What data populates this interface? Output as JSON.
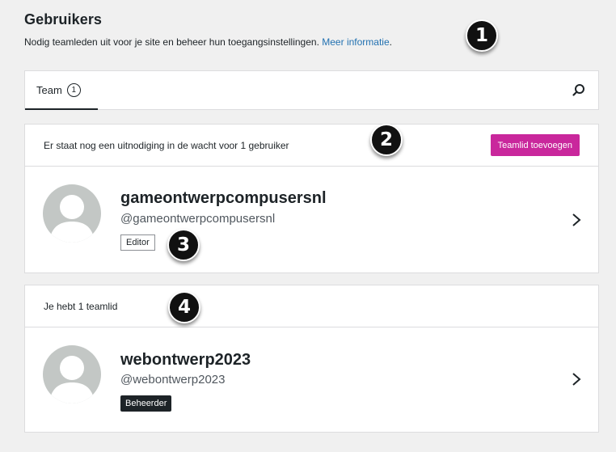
{
  "header": {
    "title": "Gebruikers",
    "subtitle": "Nodig teamleden uit voor je site en beheer hun toegangsinstellingen.",
    "link_label": "Meer informatie",
    "link_suffix": "."
  },
  "callouts": [
    "1",
    "2",
    "3",
    "4"
  ],
  "tabs": [
    {
      "label": "Team",
      "count": "1",
      "active": true
    }
  ],
  "icons": {
    "search": "search-icon",
    "chevron": "chevron-right-icon",
    "avatar": "default-avatar-icon"
  },
  "pending": {
    "message": "Er staat nog een uitnodiging in de wacht voor 1 gebruiker",
    "add_button": "Teamlid toevoegen",
    "user": {
      "name": "gameontwerpcompusersnl",
      "handle": "@gameontwerpcompusersnl",
      "role": "Editor"
    }
  },
  "team": {
    "message": "Je hebt 1 teamlid",
    "user": {
      "name": "webontwerp2023",
      "handle": "@webontwerp2023",
      "role": "Beheerder"
    }
  },
  "colors": {
    "accent": "#c9279c",
    "link": "#2271b1",
    "admin_badge": "#1d2327",
    "avatar_bg": "#c3c7c5"
  }
}
